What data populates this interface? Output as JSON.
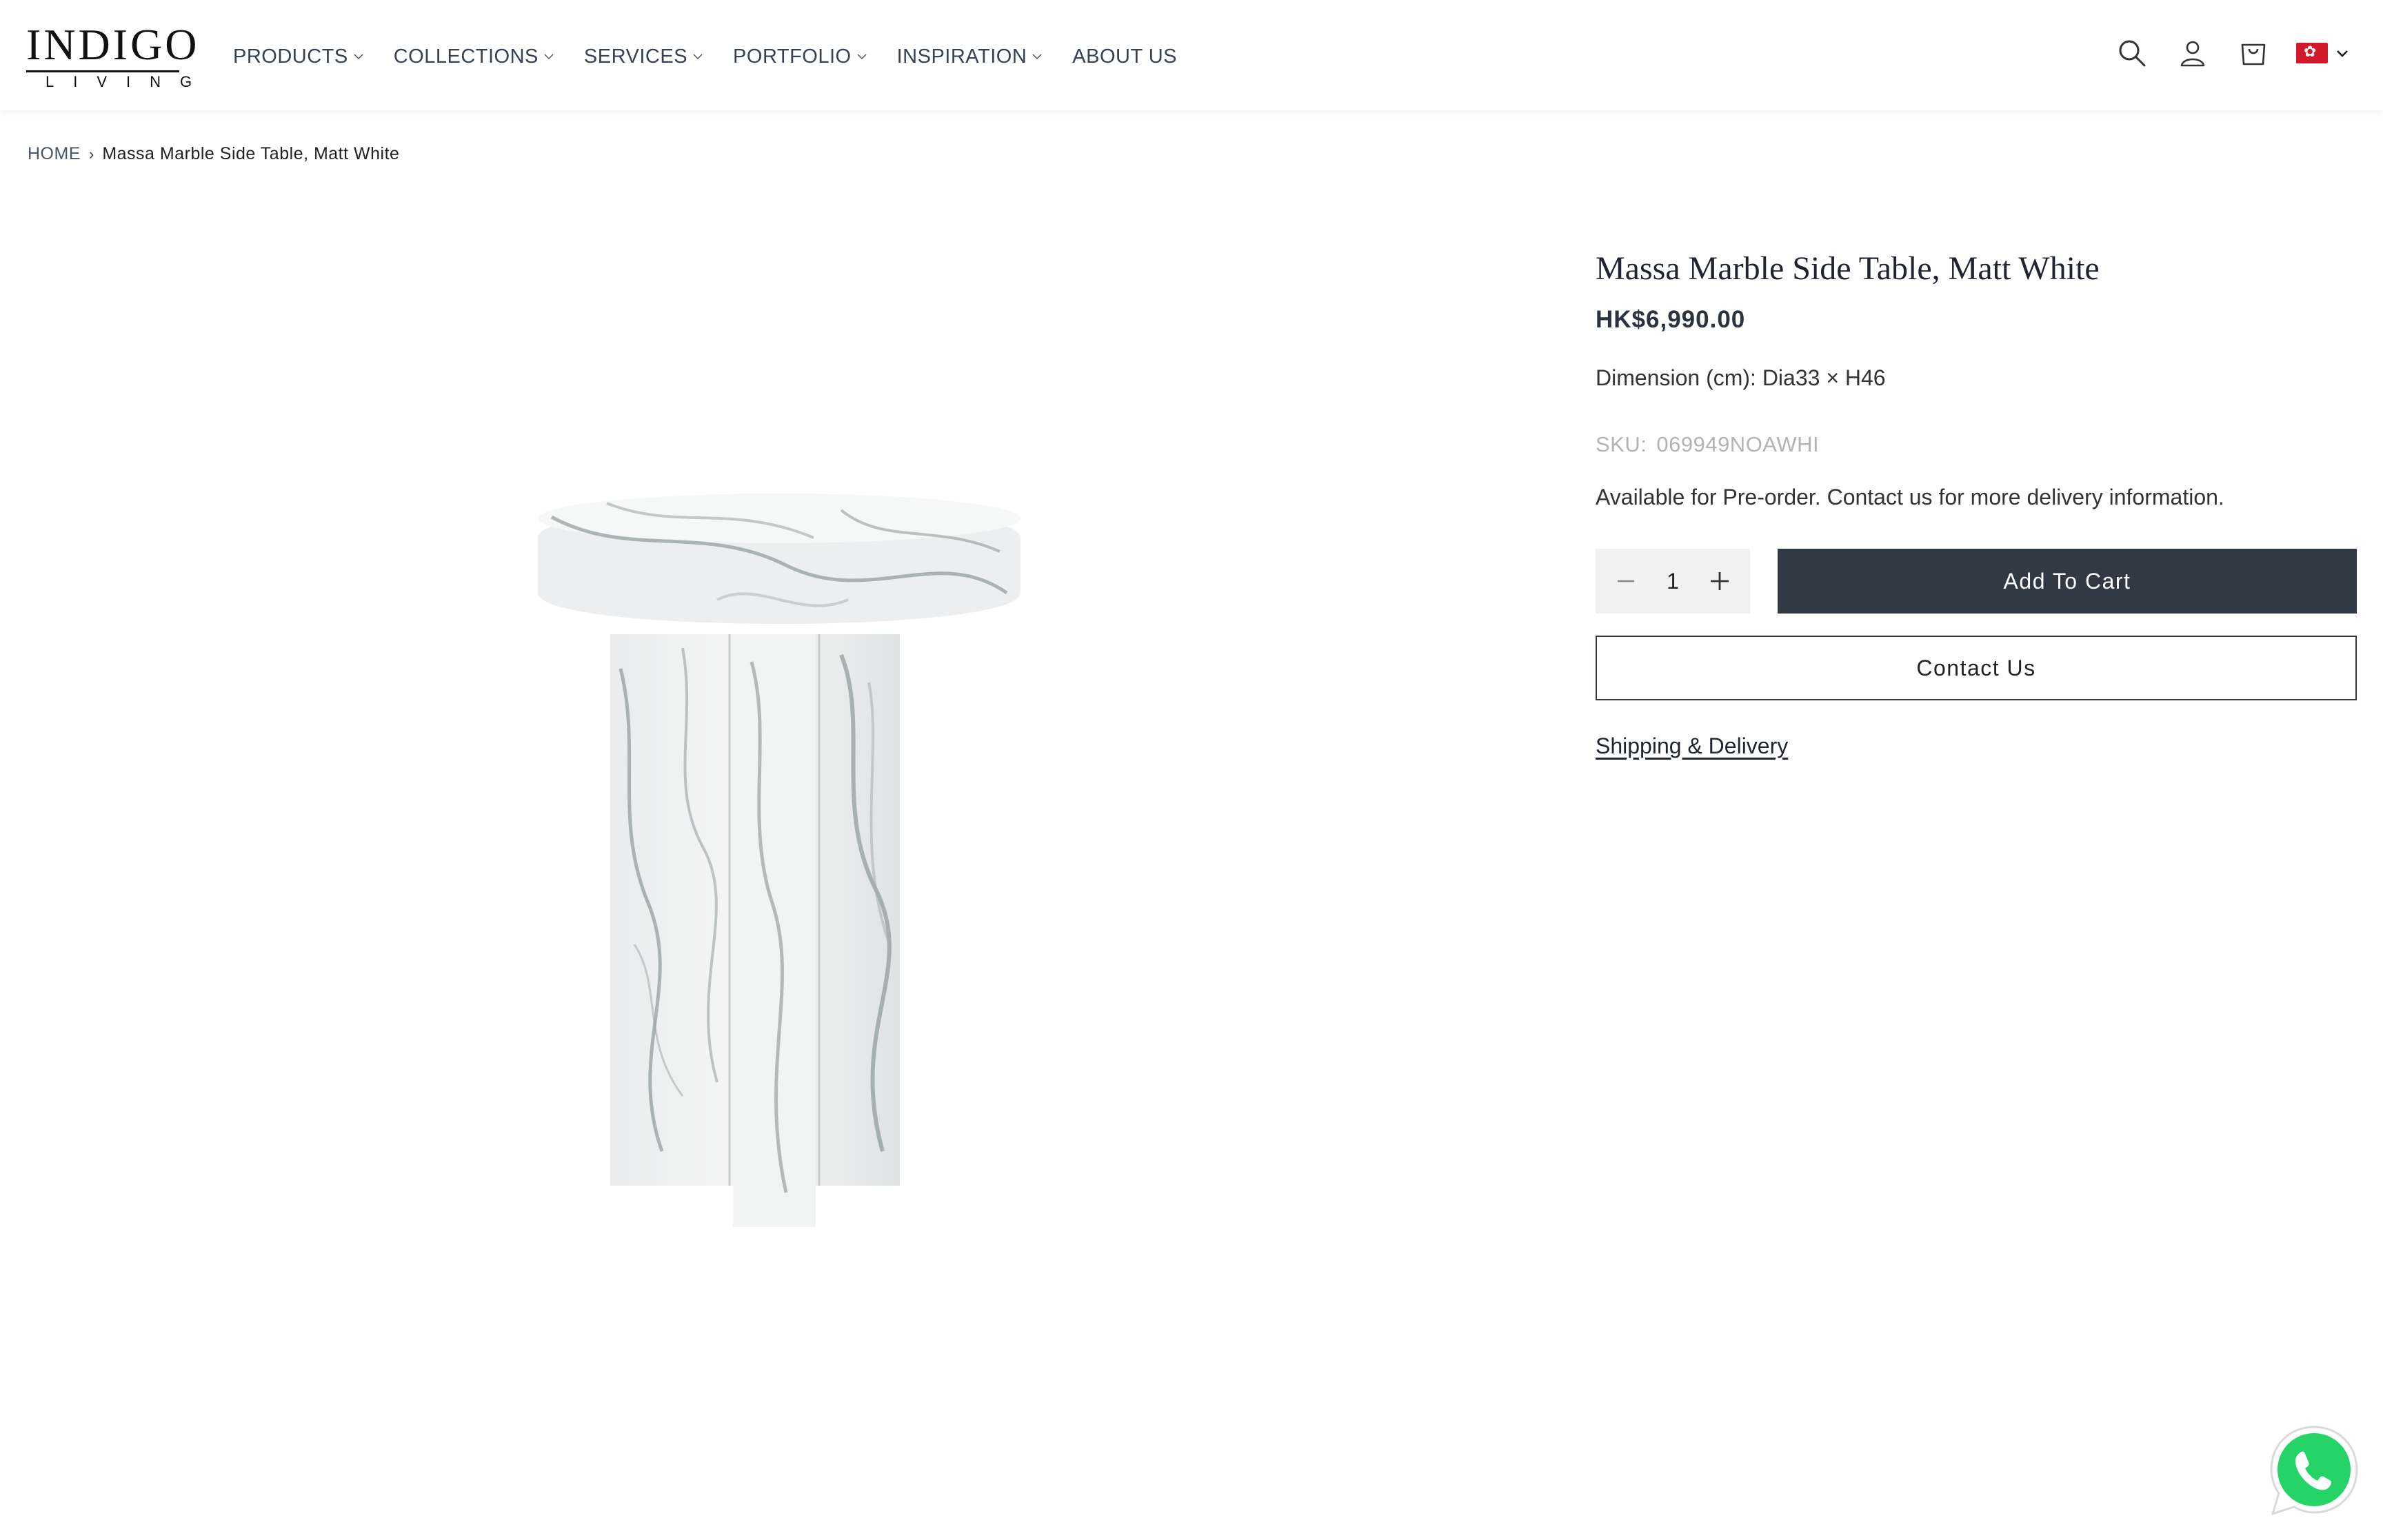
{
  "brand": {
    "logo_word": "INDIGO",
    "logo_sub": "LIVING"
  },
  "nav": {
    "items": [
      {
        "label": "PRODUCTS",
        "has_dropdown": true
      },
      {
        "label": "COLLECTIONS",
        "has_dropdown": true
      },
      {
        "label": "SERVICES",
        "has_dropdown": true
      },
      {
        "label": "PORTFOLIO",
        "has_dropdown": true
      },
      {
        "label": "INSPIRATION",
        "has_dropdown": true
      },
      {
        "label": "ABOUT US",
        "has_dropdown": false
      }
    ]
  },
  "header_icons": [
    "search-icon",
    "account-icon",
    "cart-icon",
    "hong-kong-flag-icon"
  ],
  "breadcrumb": {
    "home": "HOME",
    "separator": "›",
    "current": "Massa Marble Side Table, Matt White"
  },
  "product": {
    "title": "Massa Marble Side Table, Matt White",
    "price": "HK$6,990.00",
    "dimension": "Dimension (cm): Dia33 × H46",
    "sku_label": "SKU:",
    "sku_value": "069949NOAWHI",
    "availability": "Available for Pre-order. Contact us for more delivery information.",
    "quantity": "1",
    "add_to_cart": "Add To Cart",
    "contact_us": "Contact Us",
    "shipping_link": "Shipping & Delivery"
  },
  "colors": {
    "primary_button": "#313945",
    "nav_text": "#374152",
    "flag_red": "#d2182b",
    "whatsapp_green": "#25d366"
  }
}
